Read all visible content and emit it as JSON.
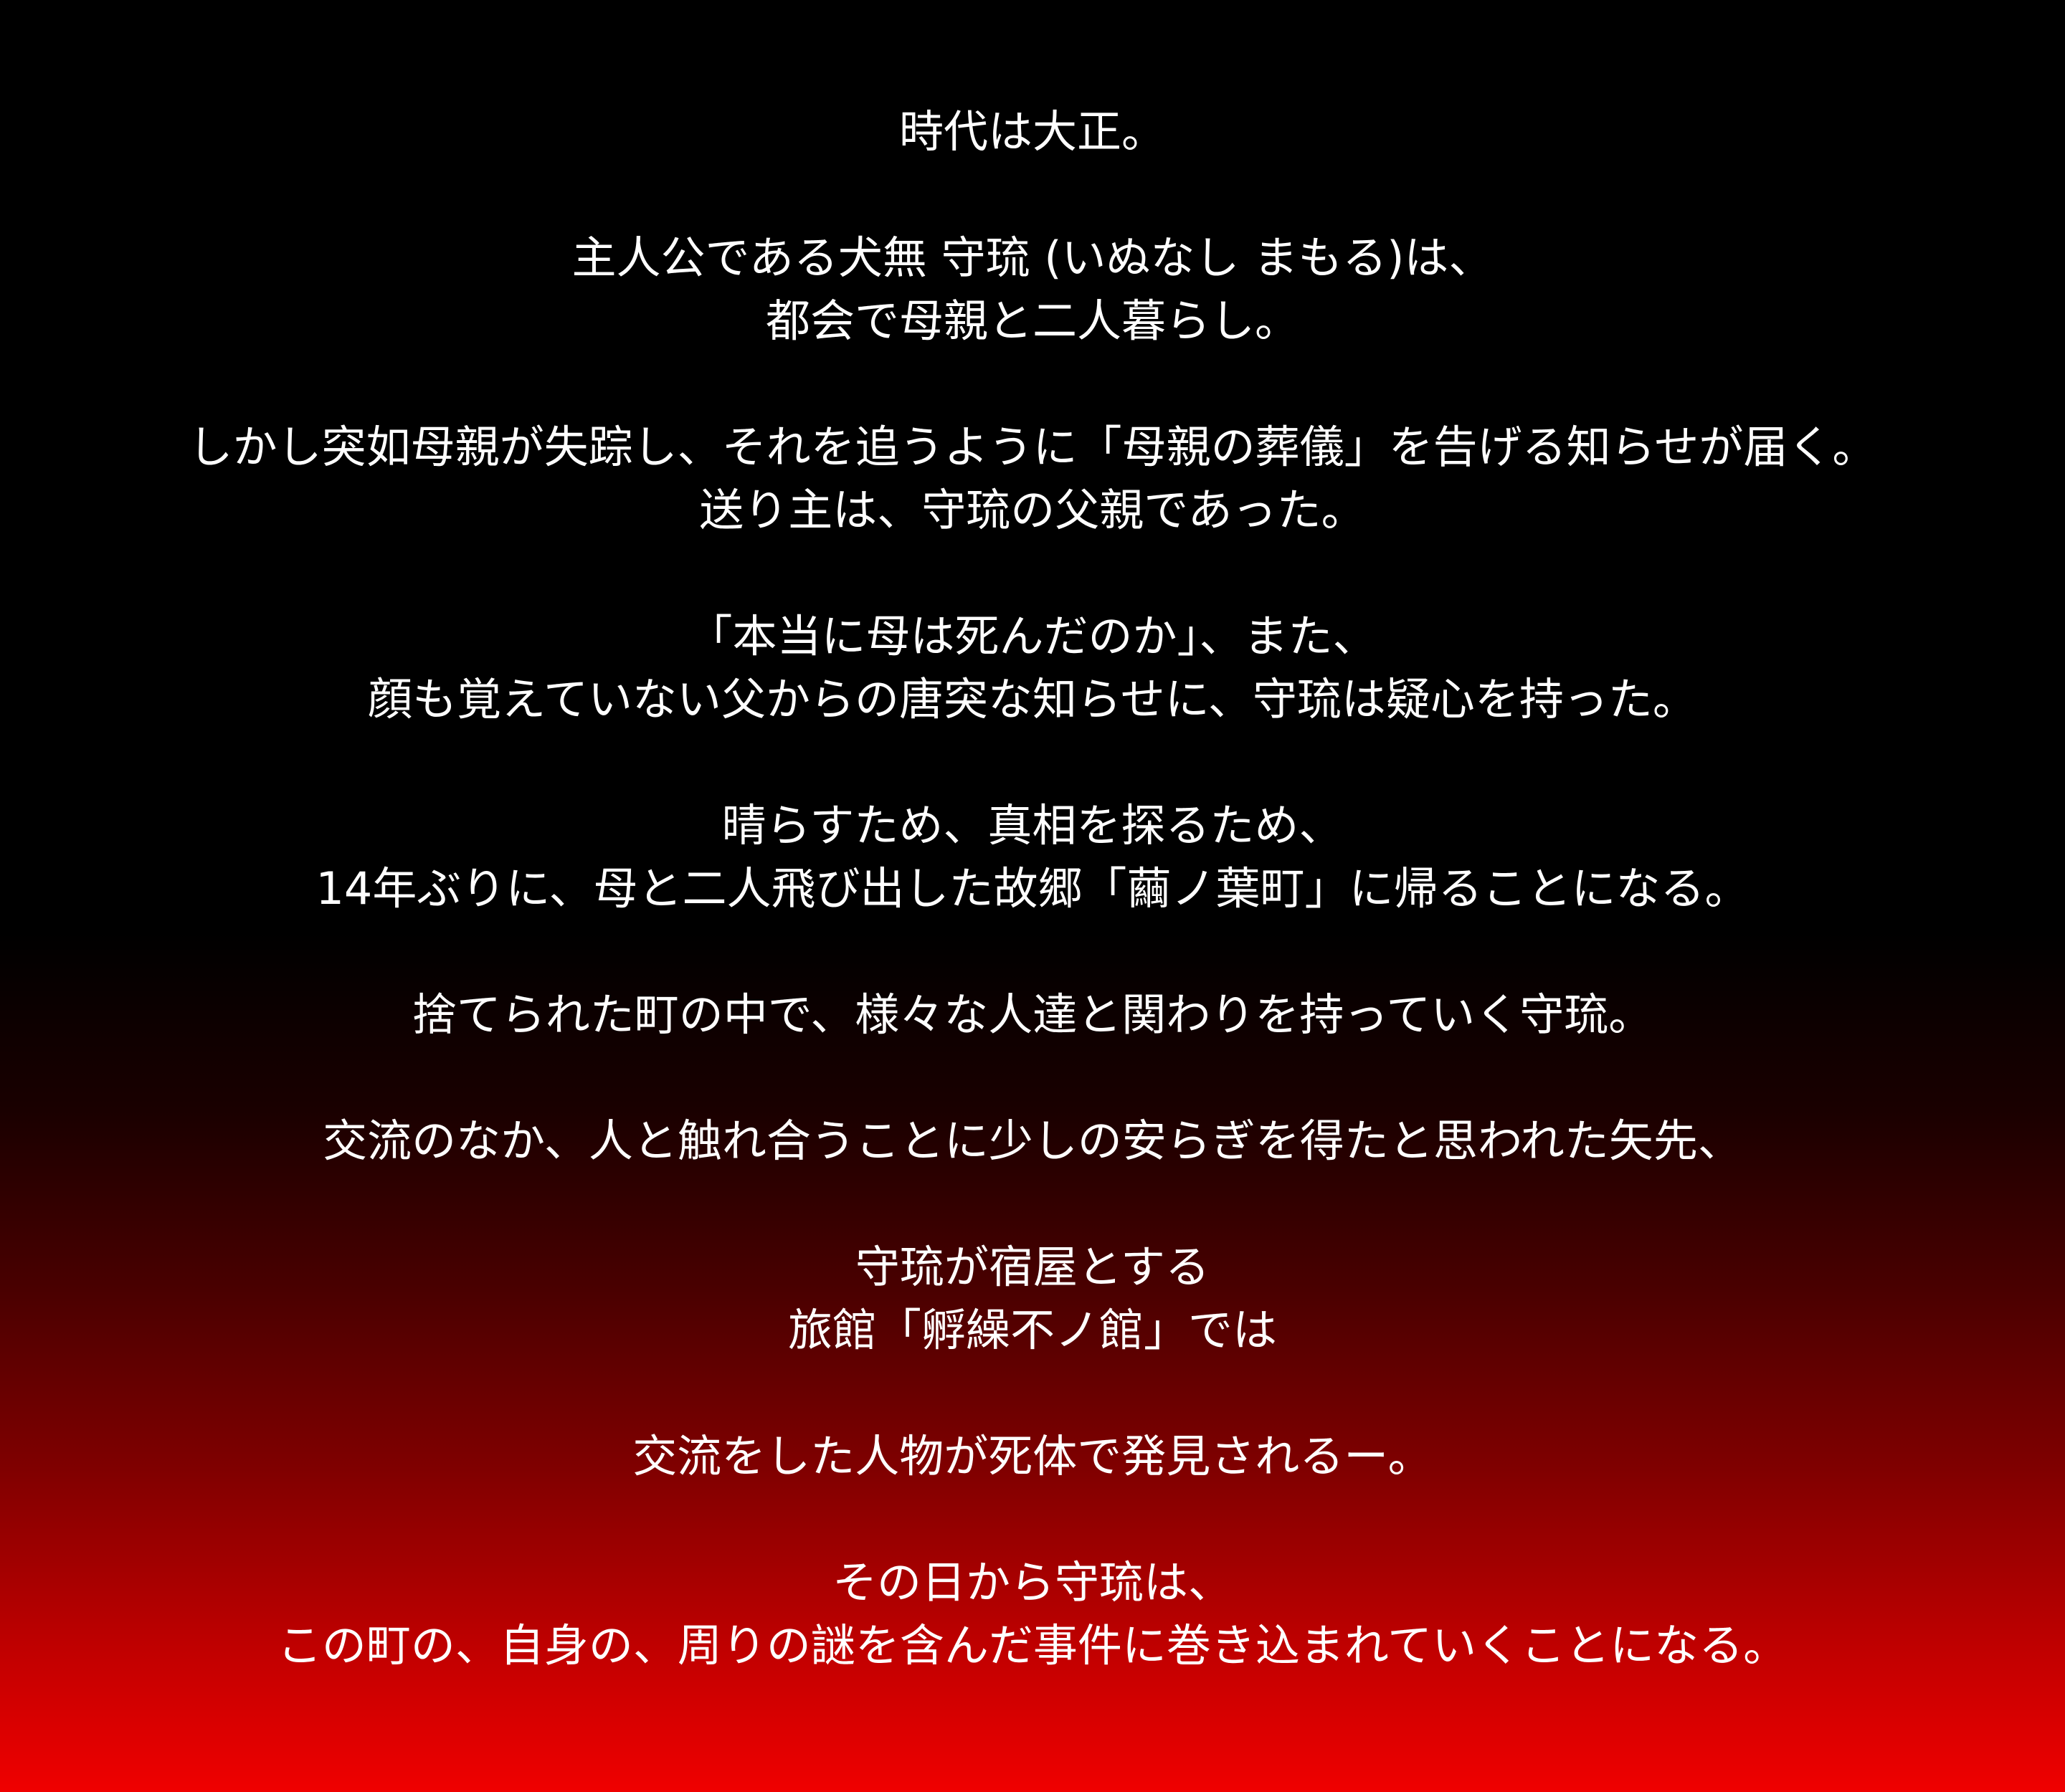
{
  "story": {
    "paragraphs": [
      [
        "時代は大正。"
      ],
      [
        "主人公である犬無 守琉 (いぬなし まもる)は、",
        "都会で母親と二人暮らし。"
      ],
      [
        "しかし突如母親が失踪し、それを追うように「母親の葬儀」を告げる知らせが届く。",
        "送り主は、守琉の父親であった。"
      ],
      [
        "「本当に母は死んだのか」、また、",
        "顔も覚えていない父からの唐突な知らせに、守琉は疑心を持った。"
      ],
      [
        "晴らすため、真相を探るため、",
        "14年ぶりに、母と二人飛び出した故郷「繭ノ葉町」に帰ることになる。"
      ],
      [
        "捨てられた町の中で、様々な人達と関わりを持っていく守琉。"
      ],
      [
        "交流のなか、人と触れ合うことに少しの安らぎを得たと思われた矢先、"
      ],
      [
        "守琉が宿屋とする",
        "旅館「孵繰不ノ館」では"
      ],
      [
        "交流をした人物が死体で発見されるー。"
      ],
      [
        "その日から守琉は、",
        "この町の、自身の、周りの謎を含んだ事件に巻き込まれていくことになる。"
      ]
    ]
  }
}
